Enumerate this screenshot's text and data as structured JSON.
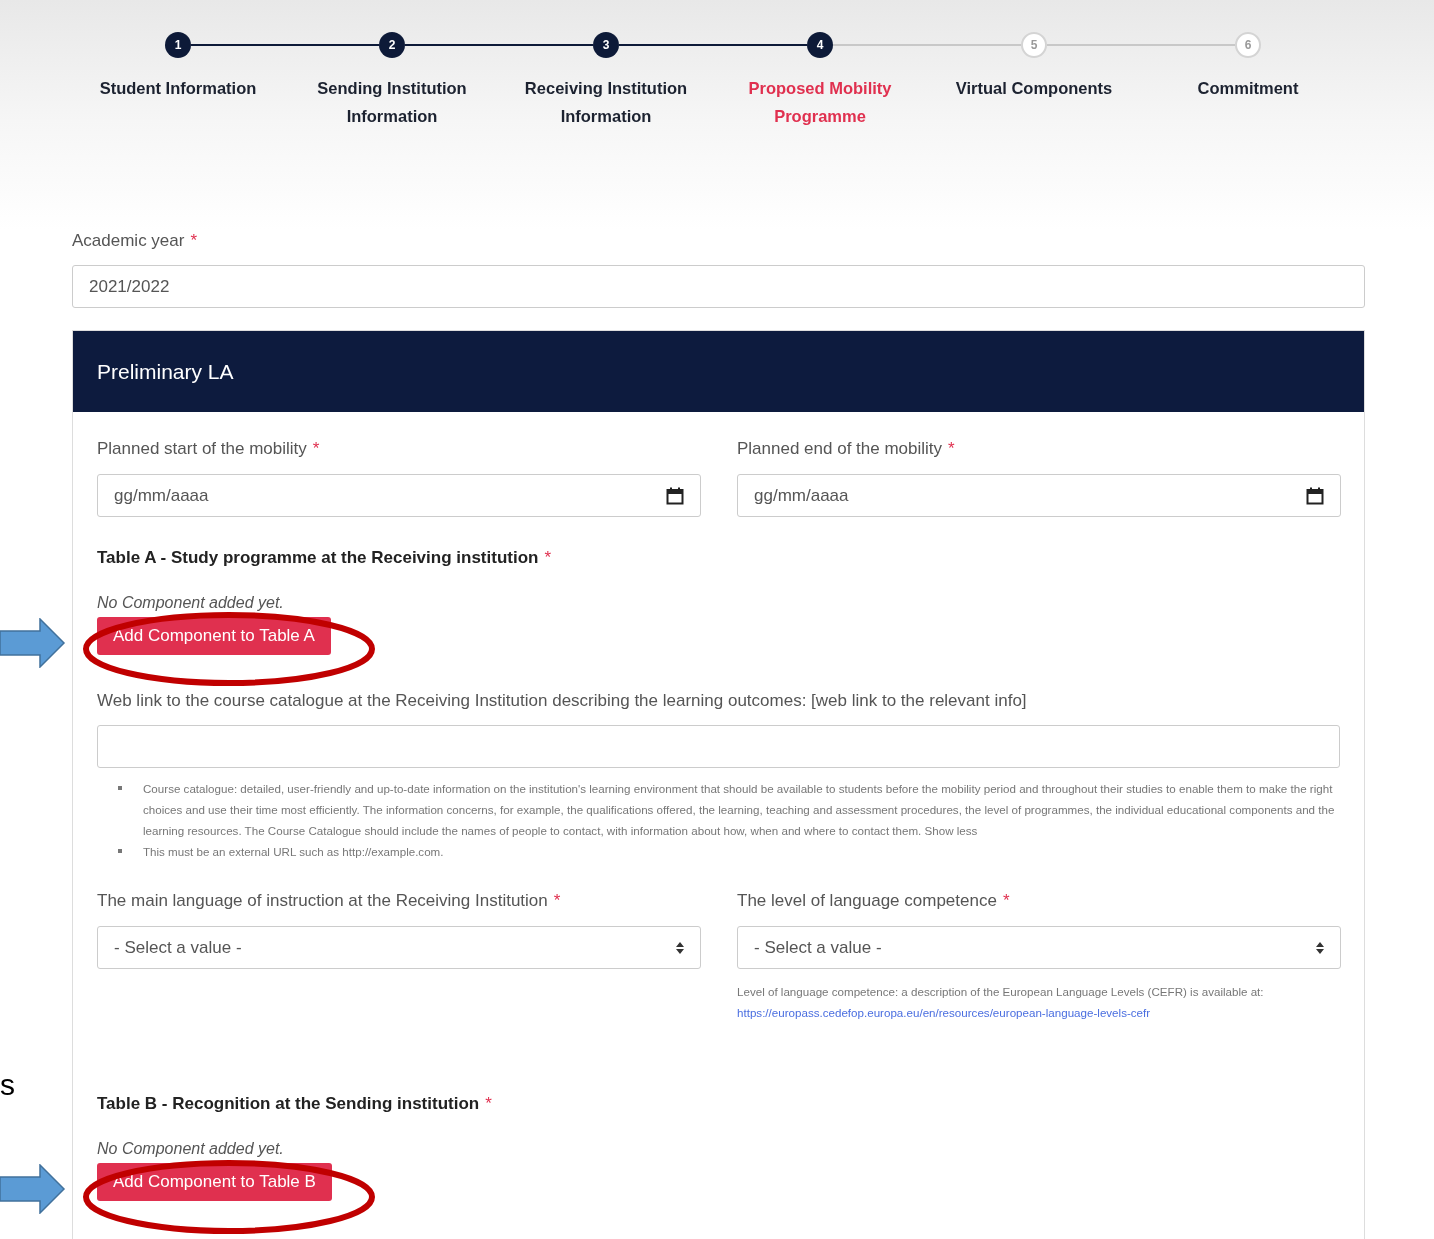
{
  "steps": [
    {
      "number": "1",
      "label": "Student Information",
      "reached": true,
      "selected": false
    },
    {
      "number": "2",
      "label": "Sending Institution Information",
      "reached": true,
      "selected": false
    },
    {
      "number": "3",
      "label": "Receiving Institution Information",
      "reached": true,
      "selected": false
    },
    {
      "number": "4",
      "label": "Proposed Mobility Programme",
      "reached": true,
      "selected": true
    },
    {
      "number": "5",
      "label": "Virtual Components",
      "reached": false,
      "selected": false
    },
    {
      "number": "6",
      "label": "Commitment",
      "reached": false,
      "selected": false
    }
  ],
  "academic_year": {
    "label": "Academic year",
    "required_mark": "*",
    "value": "2021/2022"
  },
  "panel": {
    "title": "Preliminary LA",
    "date_fields": [
      {
        "label": "Planned start of the mobility",
        "required_mark": "*",
        "placeholder": "gg/mm/aaaa"
      },
      {
        "label": "Planned end of the mobility",
        "required_mark": "*",
        "placeholder": "gg/mm/aaaa"
      }
    ],
    "table_a": {
      "title": "Table A - Study programme at the Receiving institution",
      "required_mark": "*",
      "empty_note": "No Component added yet.",
      "button": "Add Component to Table A"
    },
    "web_link": {
      "label": "Web link to the course catalogue at the Receiving Institution describing the learning outcomes: [web link to the relevant info]",
      "help": [
        "Course catalogue: detailed, user-friendly and up-to-date information on the institution's learning environment that should be available to students before the mobility period and throughout their studies to enable them to make the right choices and use their time most efficiently. The information concerns, for example, the qualifications offered, the learning, teaching and assessment procedures, the level of programmes, the individual educational components and the learning resources. The Course Catalogue should include the names of people to contact, with information about how, when and where to contact them. Show less",
        "This must be an external URL such as http://example.com."
      ]
    },
    "language_fields": [
      {
        "label": "The main language of instruction at the Receiving Institution",
        "required_mark": "*",
        "value": "- Select a value -"
      },
      {
        "label": "The level of language competence",
        "required_mark": "*",
        "value": "- Select a value -",
        "help": "Level of language competence: a description of the European Language Levels (CEFR) is available at:",
        "help_link": "https://europass.cedefop.europa.eu/en/resources/european-language-levels-cefr"
      }
    ],
    "table_b": {
      "title": "Table B - Recognition at the Sending institution",
      "required_mark": "*",
      "empty_note": "No Component added yet.",
      "button": "Add Component to Table B"
    }
  },
  "annotations": [
    {
      "kind": "arrow"
    },
    {
      "kind": "ellipse"
    },
    {
      "kind": "text",
      "text": "s"
    },
    {
      "kind": "arrow"
    },
    {
      "kind": "ellipse"
    }
  ]
}
